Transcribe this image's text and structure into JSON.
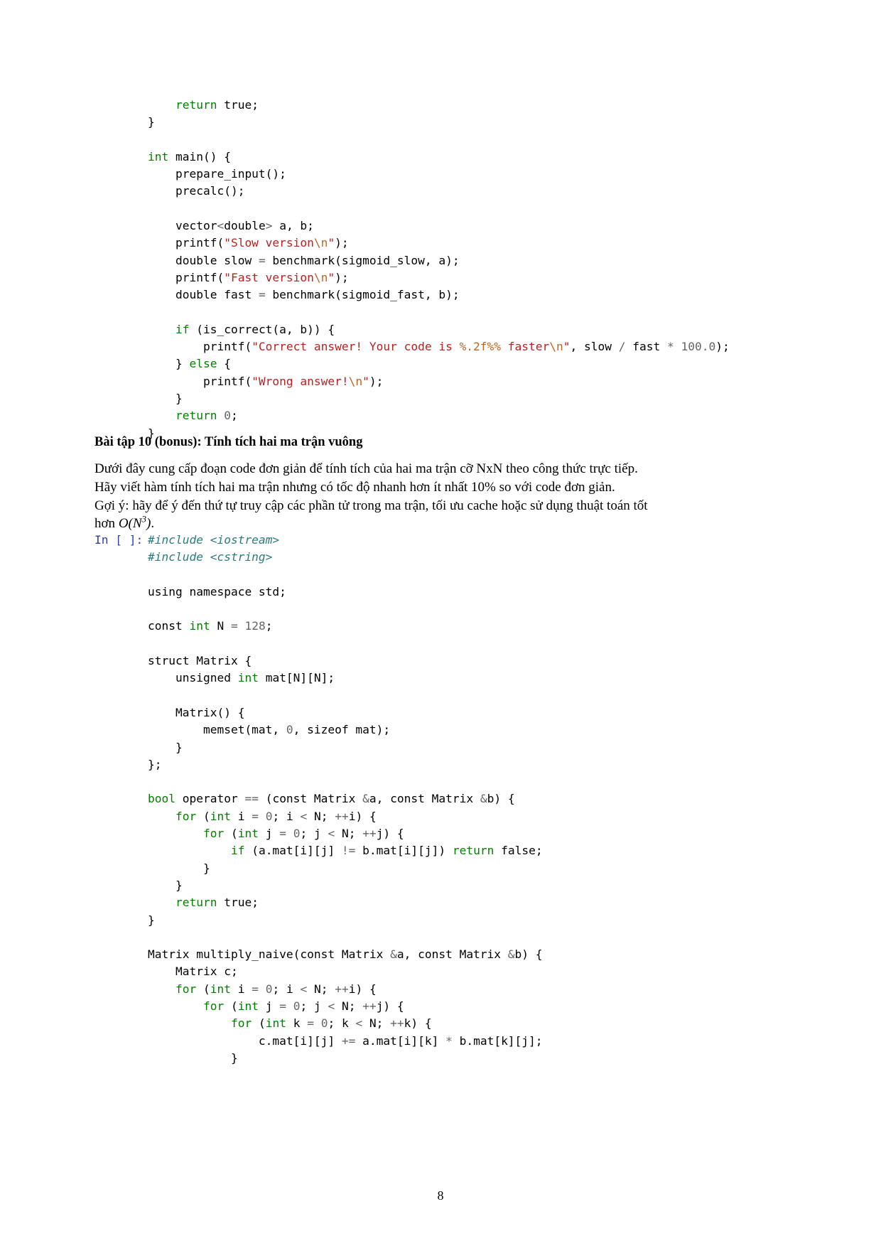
{
  "document": {
    "page_number": "8",
    "font_note": "notebook-pdf-export"
  },
  "code_block_top": {
    "prompt": "",
    "lines": [
      [
        {
          "t": "    ",
          "c": "plain"
        },
        {
          "t": "return",
          "c": "k"
        },
        {
          "t": " true;",
          "c": "plain"
        }
      ],
      [
        {
          "t": "}",
          "c": "plain"
        }
      ],
      [
        {
          "t": "",
          "c": "plain"
        }
      ],
      [
        {
          "t": "int",
          "c": "k"
        },
        {
          "t": " main() {",
          "c": "plain"
        }
      ],
      [
        {
          "t": "    prepare_input();",
          "c": "plain"
        }
      ],
      [
        {
          "t": "    precalc();",
          "c": "plain"
        }
      ],
      [
        {
          "t": "",
          "c": "plain"
        }
      ],
      [
        {
          "t": "    vector",
          "c": "plain"
        },
        {
          "t": "<",
          "c": "o"
        },
        {
          "t": "double",
          "c": "plain"
        },
        {
          "t": ">",
          "c": "o"
        },
        {
          "t": " a, b;",
          "c": "plain"
        }
      ],
      [
        {
          "t": "    printf(",
          "c": "plain"
        },
        {
          "t": "\"Slow version",
          "c": "s"
        },
        {
          "t": "\\n",
          "c": "se"
        },
        {
          "t": "\"",
          "c": "s"
        },
        {
          "t": ");",
          "c": "plain"
        }
      ],
      [
        {
          "t": "    double slow ",
          "c": "plain"
        },
        {
          "t": "=",
          "c": "o"
        },
        {
          "t": " benchmark(sigmoid_slow, a);",
          "c": "plain"
        }
      ],
      [
        {
          "t": "    printf(",
          "c": "plain"
        },
        {
          "t": "\"Fast version",
          "c": "s"
        },
        {
          "t": "\\n",
          "c": "se"
        },
        {
          "t": "\"",
          "c": "s"
        },
        {
          "t": ");",
          "c": "plain"
        }
      ],
      [
        {
          "t": "    double fast ",
          "c": "plain"
        },
        {
          "t": "=",
          "c": "o"
        },
        {
          "t": " benchmark(sigmoid_fast, b);",
          "c": "plain"
        }
      ],
      [
        {
          "t": "",
          "c": "plain"
        }
      ],
      [
        {
          "t": "    ",
          "c": "plain"
        },
        {
          "t": "if",
          "c": "k"
        },
        {
          "t": " (is_correct(a, b)) {",
          "c": "plain"
        }
      ],
      [
        {
          "t": "        printf(",
          "c": "plain"
        },
        {
          "t": "\"Correct answer! Your code is ",
          "c": "s"
        },
        {
          "t": "%.2f%%",
          "c": "se"
        },
        {
          "t": " faster",
          "c": "s"
        },
        {
          "t": "\\n",
          "c": "se"
        },
        {
          "t": "\"",
          "c": "s"
        },
        {
          "t": ", slow ",
          "c": "plain"
        },
        {
          "t": "/",
          "c": "o"
        },
        {
          "t": " fast ",
          "c": "plain"
        },
        {
          "t": "*",
          "c": "o"
        },
        {
          "t": " ",
          "c": "plain"
        },
        {
          "t": "100.0",
          "c": "n"
        },
        {
          "t": ");",
          "c": "plain"
        }
      ],
      [
        {
          "t": "    } ",
          "c": "plain"
        },
        {
          "t": "else",
          "c": "k"
        },
        {
          "t": " {",
          "c": "plain"
        }
      ],
      [
        {
          "t": "        printf(",
          "c": "plain"
        },
        {
          "t": "\"Wrong answer!",
          "c": "s"
        },
        {
          "t": "\\n",
          "c": "se"
        },
        {
          "t": "\"",
          "c": "s"
        },
        {
          "t": ");",
          "c": "plain"
        }
      ],
      [
        {
          "t": "    }",
          "c": "plain"
        }
      ],
      [
        {
          "t": "    ",
          "c": "plain"
        },
        {
          "t": "return",
          "c": "k"
        },
        {
          "t": " ",
          "c": "plain"
        },
        {
          "t": "0",
          "c": "n"
        },
        {
          "t": ";",
          "c": "plain"
        }
      ],
      [
        {
          "t": "}",
          "c": "plain"
        }
      ]
    ]
  },
  "exercise": {
    "heading": "Bài tập 10 (bonus): Tính tích hai ma trận vuông",
    "paragraph_lines": [
      "Dưới đây cung cấp đoạn code đơn giản để tính tích của hai ma trận cỡ NxN theo công thức trực tiếp.",
      "Hãy viết hàm tính tích hai ma trận nhưng có tốc độ nhanh hơn ít nhất 10% so với code đơn giản.",
      "Gợi ý: hãy để ý đến thứ tự truy cập các phần tử trong ma trận, tối ưu cache hoặc sử dụng thuật toán tốt"
    ],
    "paragraph_last_prefix": "hơn ",
    "paragraph_math_base": "O(N",
    "paragraph_math_exp": "3",
    "paragraph_math_suffix": ")",
    "paragraph_last_suffix": "."
  },
  "code_block_bottom": {
    "prompt": "In [ ]:",
    "lines": [
      [
        {
          "t": "#include <iostream>",
          "c": "cp"
        }
      ],
      [
        {
          "t": "#include <cstring>",
          "c": "cp"
        }
      ],
      [
        {
          "t": "",
          "c": "plain"
        }
      ],
      [
        {
          "t": "using namespace std;",
          "c": "plain"
        }
      ],
      [
        {
          "t": "",
          "c": "plain"
        }
      ],
      [
        {
          "t": "const ",
          "c": "plain"
        },
        {
          "t": "int",
          "c": "k"
        },
        {
          "t": " N ",
          "c": "plain"
        },
        {
          "t": "=",
          "c": "o"
        },
        {
          "t": " ",
          "c": "plain"
        },
        {
          "t": "128",
          "c": "n"
        },
        {
          "t": ";",
          "c": "plain"
        }
      ],
      [
        {
          "t": "",
          "c": "plain"
        }
      ],
      [
        {
          "t": "struct Matrix {",
          "c": "plain"
        }
      ],
      [
        {
          "t": "    unsigned ",
          "c": "plain"
        },
        {
          "t": "int",
          "c": "k"
        },
        {
          "t": " mat[N][N];",
          "c": "plain"
        }
      ],
      [
        {
          "t": "",
          "c": "plain"
        }
      ],
      [
        {
          "t": "    Matrix() {",
          "c": "plain"
        }
      ],
      [
        {
          "t": "        memset(mat, ",
          "c": "plain"
        },
        {
          "t": "0",
          "c": "n"
        },
        {
          "t": ", sizeof mat);",
          "c": "plain"
        }
      ],
      [
        {
          "t": "    }",
          "c": "plain"
        }
      ],
      [
        {
          "t": "};",
          "c": "plain"
        }
      ],
      [
        {
          "t": "",
          "c": "plain"
        }
      ],
      [
        {
          "t": "bool",
          "c": "k"
        },
        {
          "t": " operator ",
          "c": "plain"
        },
        {
          "t": "==",
          "c": "o"
        },
        {
          "t": " (const Matrix ",
          "c": "plain"
        },
        {
          "t": "&",
          "c": "o"
        },
        {
          "t": "a, const Matrix ",
          "c": "plain"
        },
        {
          "t": "&",
          "c": "o"
        },
        {
          "t": "b) {",
          "c": "plain"
        }
      ],
      [
        {
          "t": "    ",
          "c": "plain"
        },
        {
          "t": "for",
          "c": "k"
        },
        {
          "t": " (",
          "c": "plain"
        },
        {
          "t": "int",
          "c": "k"
        },
        {
          "t": " i ",
          "c": "plain"
        },
        {
          "t": "=",
          "c": "o"
        },
        {
          "t": " ",
          "c": "plain"
        },
        {
          "t": "0",
          "c": "n"
        },
        {
          "t": "; i ",
          "c": "plain"
        },
        {
          "t": "<",
          "c": "o"
        },
        {
          "t": " N; ",
          "c": "plain"
        },
        {
          "t": "++",
          "c": "o"
        },
        {
          "t": "i) {",
          "c": "plain"
        }
      ],
      [
        {
          "t": "        ",
          "c": "plain"
        },
        {
          "t": "for",
          "c": "k"
        },
        {
          "t": " (",
          "c": "plain"
        },
        {
          "t": "int",
          "c": "k"
        },
        {
          "t": " j ",
          "c": "plain"
        },
        {
          "t": "=",
          "c": "o"
        },
        {
          "t": " ",
          "c": "plain"
        },
        {
          "t": "0",
          "c": "n"
        },
        {
          "t": "; j ",
          "c": "plain"
        },
        {
          "t": "<",
          "c": "o"
        },
        {
          "t": " N; ",
          "c": "plain"
        },
        {
          "t": "++",
          "c": "o"
        },
        {
          "t": "j) {",
          "c": "plain"
        }
      ],
      [
        {
          "t": "            ",
          "c": "plain"
        },
        {
          "t": "if",
          "c": "k"
        },
        {
          "t": " (a.mat[i][j] ",
          "c": "plain"
        },
        {
          "t": "!=",
          "c": "o"
        },
        {
          "t": " b.mat[i][j]) ",
          "c": "plain"
        },
        {
          "t": "return",
          "c": "k"
        },
        {
          "t": " false;",
          "c": "plain"
        }
      ],
      [
        {
          "t": "        }",
          "c": "plain"
        }
      ],
      [
        {
          "t": "    }",
          "c": "plain"
        }
      ],
      [
        {
          "t": "    ",
          "c": "plain"
        },
        {
          "t": "return",
          "c": "k"
        },
        {
          "t": " true;",
          "c": "plain"
        }
      ],
      [
        {
          "t": "}",
          "c": "plain"
        }
      ],
      [
        {
          "t": "",
          "c": "plain"
        }
      ],
      [
        {
          "t": "Matrix multiply_naive(const Matrix ",
          "c": "plain"
        },
        {
          "t": "&",
          "c": "o"
        },
        {
          "t": "a, const Matrix ",
          "c": "plain"
        },
        {
          "t": "&",
          "c": "o"
        },
        {
          "t": "b) {",
          "c": "plain"
        }
      ],
      [
        {
          "t": "    Matrix c;",
          "c": "plain"
        }
      ],
      [
        {
          "t": "    ",
          "c": "plain"
        },
        {
          "t": "for",
          "c": "k"
        },
        {
          "t": " (",
          "c": "plain"
        },
        {
          "t": "int",
          "c": "k"
        },
        {
          "t": " i ",
          "c": "plain"
        },
        {
          "t": "=",
          "c": "o"
        },
        {
          "t": " ",
          "c": "plain"
        },
        {
          "t": "0",
          "c": "n"
        },
        {
          "t": "; i ",
          "c": "plain"
        },
        {
          "t": "<",
          "c": "o"
        },
        {
          "t": " N; ",
          "c": "plain"
        },
        {
          "t": "++",
          "c": "o"
        },
        {
          "t": "i) {",
          "c": "plain"
        }
      ],
      [
        {
          "t": "        ",
          "c": "plain"
        },
        {
          "t": "for",
          "c": "k"
        },
        {
          "t": " (",
          "c": "plain"
        },
        {
          "t": "int",
          "c": "k"
        },
        {
          "t": " j ",
          "c": "plain"
        },
        {
          "t": "=",
          "c": "o"
        },
        {
          "t": " ",
          "c": "plain"
        },
        {
          "t": "0",
          "c": "n"
        },
        {
          "t": "; j ",
          "c": "plain"
        },
        {
          "t": "<",
          "c": "o"
        },
        {
          "t": " N; ",
          "c": "plain"
        },
        {
          "t": "++",
          "c": "o"
        },
        {
          "t": "j) {",
          "c": "plain"
        }
      ],
      [
        {
          "t": "            ",
          "c": "plain"
        },
        {
          "t": "for",
          "c": "k"
        },
        {
          "t": " (",
          "c": "plain"
        },
        {
          "t": "int",
          "c": "k"
        },
        {
          "t": " k ",
          "c": "plain"
        },
        {
          "t": "=",
          "c": "o"
        },
        {
          "t": " ",
          "c": "plain"
        },
        {
          "t": "0",
          "c": "n"
        },
        {
          "t": "; k ",
          "c": "plain"
        },
        {
          "t": "<",
          "c": "o"
        },
        {
          "t": " N; ",
          "c": "plain"
        },
        {
          "t": "++",
          "c": "o"
        },
        {
          "t": "k) {",
          "c": "plain"
        }
      ],
      [
        {
          "t": "                c.mat[i][j] ",
          "c": "plain"
        },
        {
          "t": "+=",
          "c": "o"
        },
        {
          "t": " a.mat[i][k] ",
          "c": "plain"
        },
        {
          "t": "*",
          "c": "o"
        },
        {
          "t": " b.mat[k][j];",
          "c": "plain"
        }
      ],
      [
        {
          "t": "            }",
          "c": "plain"
        }
      ]
    ]
  }
}
